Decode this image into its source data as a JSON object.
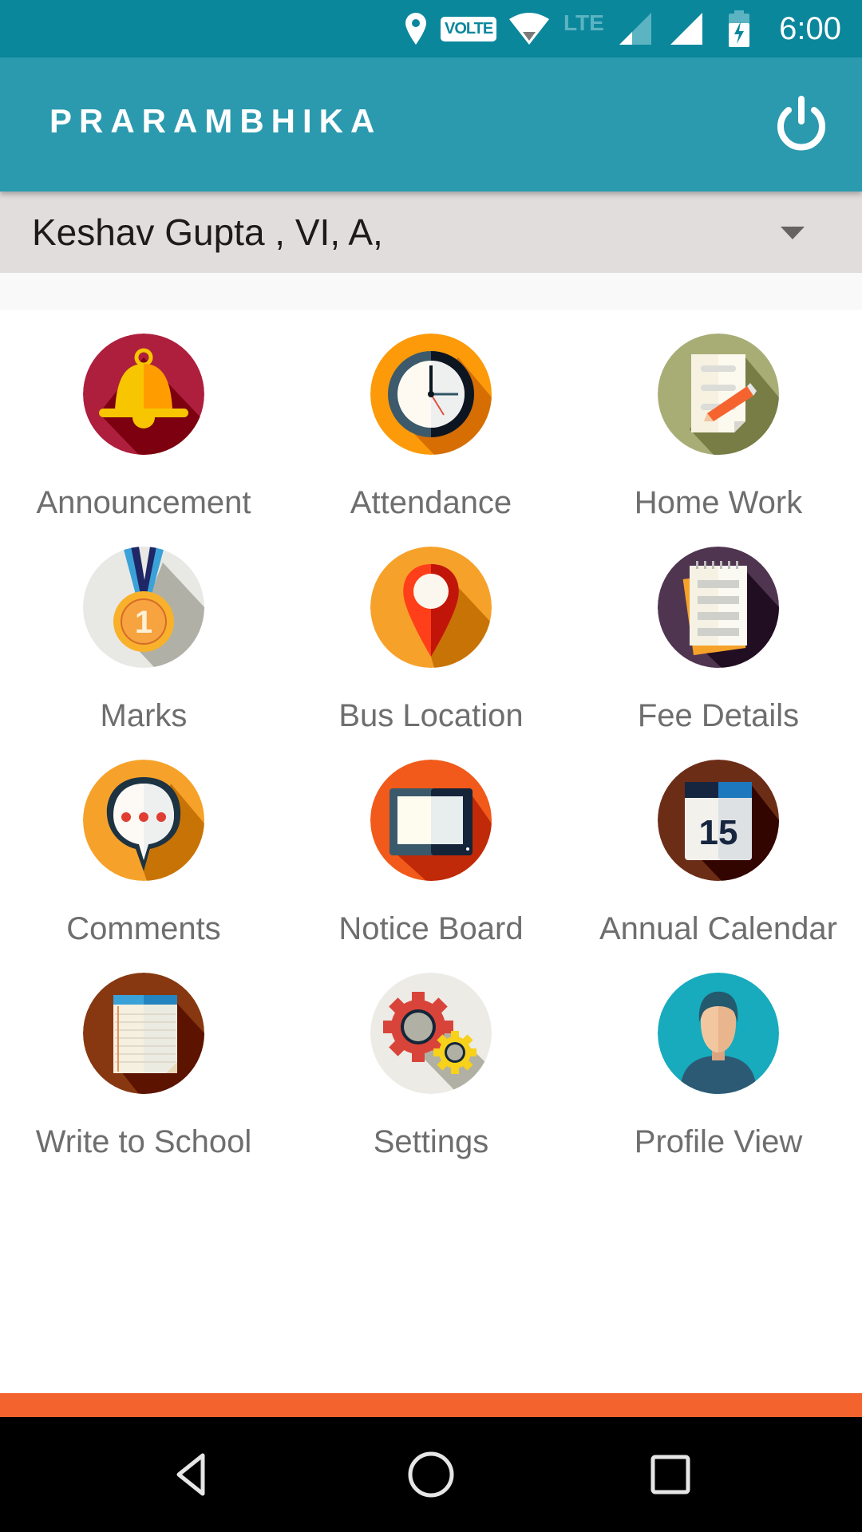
{
  "status_bar": {
    "time": "6:00",
    "volte_label": "VOLTE",
    "lte_label": "LTE",
    "icons": [
      "location-icon",
      "volte-icon",
      "wifi-icon",
      "lte-icon",
      "signal-sim1-icon",
      "signal-sim2-icon",
      "battery-charging-icon"
    ]
  },
  "app_bar": {
    "title": "PRARAMBHIKA",
    "power_icon": "power-icon"
  },
  "student_selector": {
    "selected": "Keshav Gupta , VI, A,"
  },
  "menu": [
    {
      "label": "Announcement",
      "icon": "bell-icon"
    },
    {
      "label": "Attendance",
      "icon": "clock-icon"
    },
    {
      "label": "Home Work",
      "icon": "document-pencil-icon"
    },
    {
      "label": "Marks",
      "icon": "medal-icon"
    },
    {
      "label": "Bus Location",
      "icon": "map-pin-icon"
    },
    {
      "label": "Fee Details",
      "icon": "notepad-icon"
    },
    {
      "label": "Comments",
      "icon": "speech-bubble-icon"
    },
    {
      "label": "Notice Board",
      "icon": "tablet-board-icon"
    },
    {
      "label": "Annual Calendar",
      "icon": "calendar-icon"
    },
    {
      "label": "Write to School",
      "icon": "notebook-icon"
    },
    {
      "label": "Settings",
      "icon": "gears-icon"
    },
    {
      "label": "Profile View",
      "icon": "user-avatar-icon"
    }
  ],
  "calendar_day": "15",
  "medal_number": "1",
  "colors": {
    "status_bar": "#0b879c",
    "app_bar": "#2b9aae",
    "spinner_bg": "#e1dddd",
    "accent_bar": "#f2632d",
    "label_text": "#6e6e6e"
  },
  "nav_bar": {
    "buttons": [
      "back-icon",
      "home-icon",
      "recents-icon"
    ]
  }
}
